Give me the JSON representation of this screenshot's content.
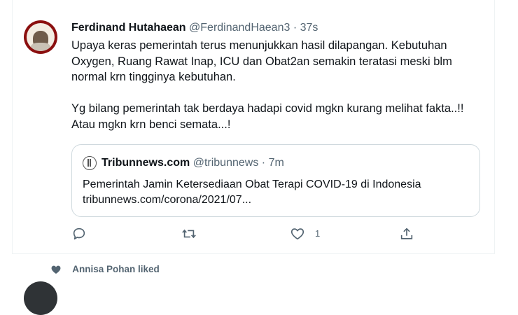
{
  "tweet": {
    "author_name": "Ferdinand Hutahaean",
    "author_handle": "@FerdinandHaean3",
    "separator": "·",
    "time": "37s",
    "text": "Upaya keras pemerintah terus menunjukkan hasil dilapangan. Kebutuhan Oxygen, Ruang Rawat Inap, ICU dan Obat2an semakin teratasi meski blm normal krn tingginya kebutuhan.\n\nYg bilang pemerintah tak berdaya hadapi covid mgkn kurang melihat fakta..!! Atau mgkn krn benci semata...!"
  },
  "quote": {
    "name": "Tribunnews.com",
    "handle": "@tribunnews",
    "separator": "·",
    "time": "7m",
    "text": "Pemerintah Jamin Ketersediaan Obat Terapi COVID-19 di Indonesia\ntribunnews.com/corona/2021/07..."
  },
  "actions": {
    "reply_icon": "reply-icon",
    "retweet_icon": "retweet-icon",
    "like_icon": "heart-icon",
    "like_count": "1",
    "share_icon": "share-icon"
  },
  "activity": {
    "liked_text": "Annisa Pohan liked",
    "icon": "heart-filled-icon"
  },
  "colors": {
    "secondary_text": "#536471",
    "border": "#cfd9de",
    "primary_text": "#0f1419"
  }
}
